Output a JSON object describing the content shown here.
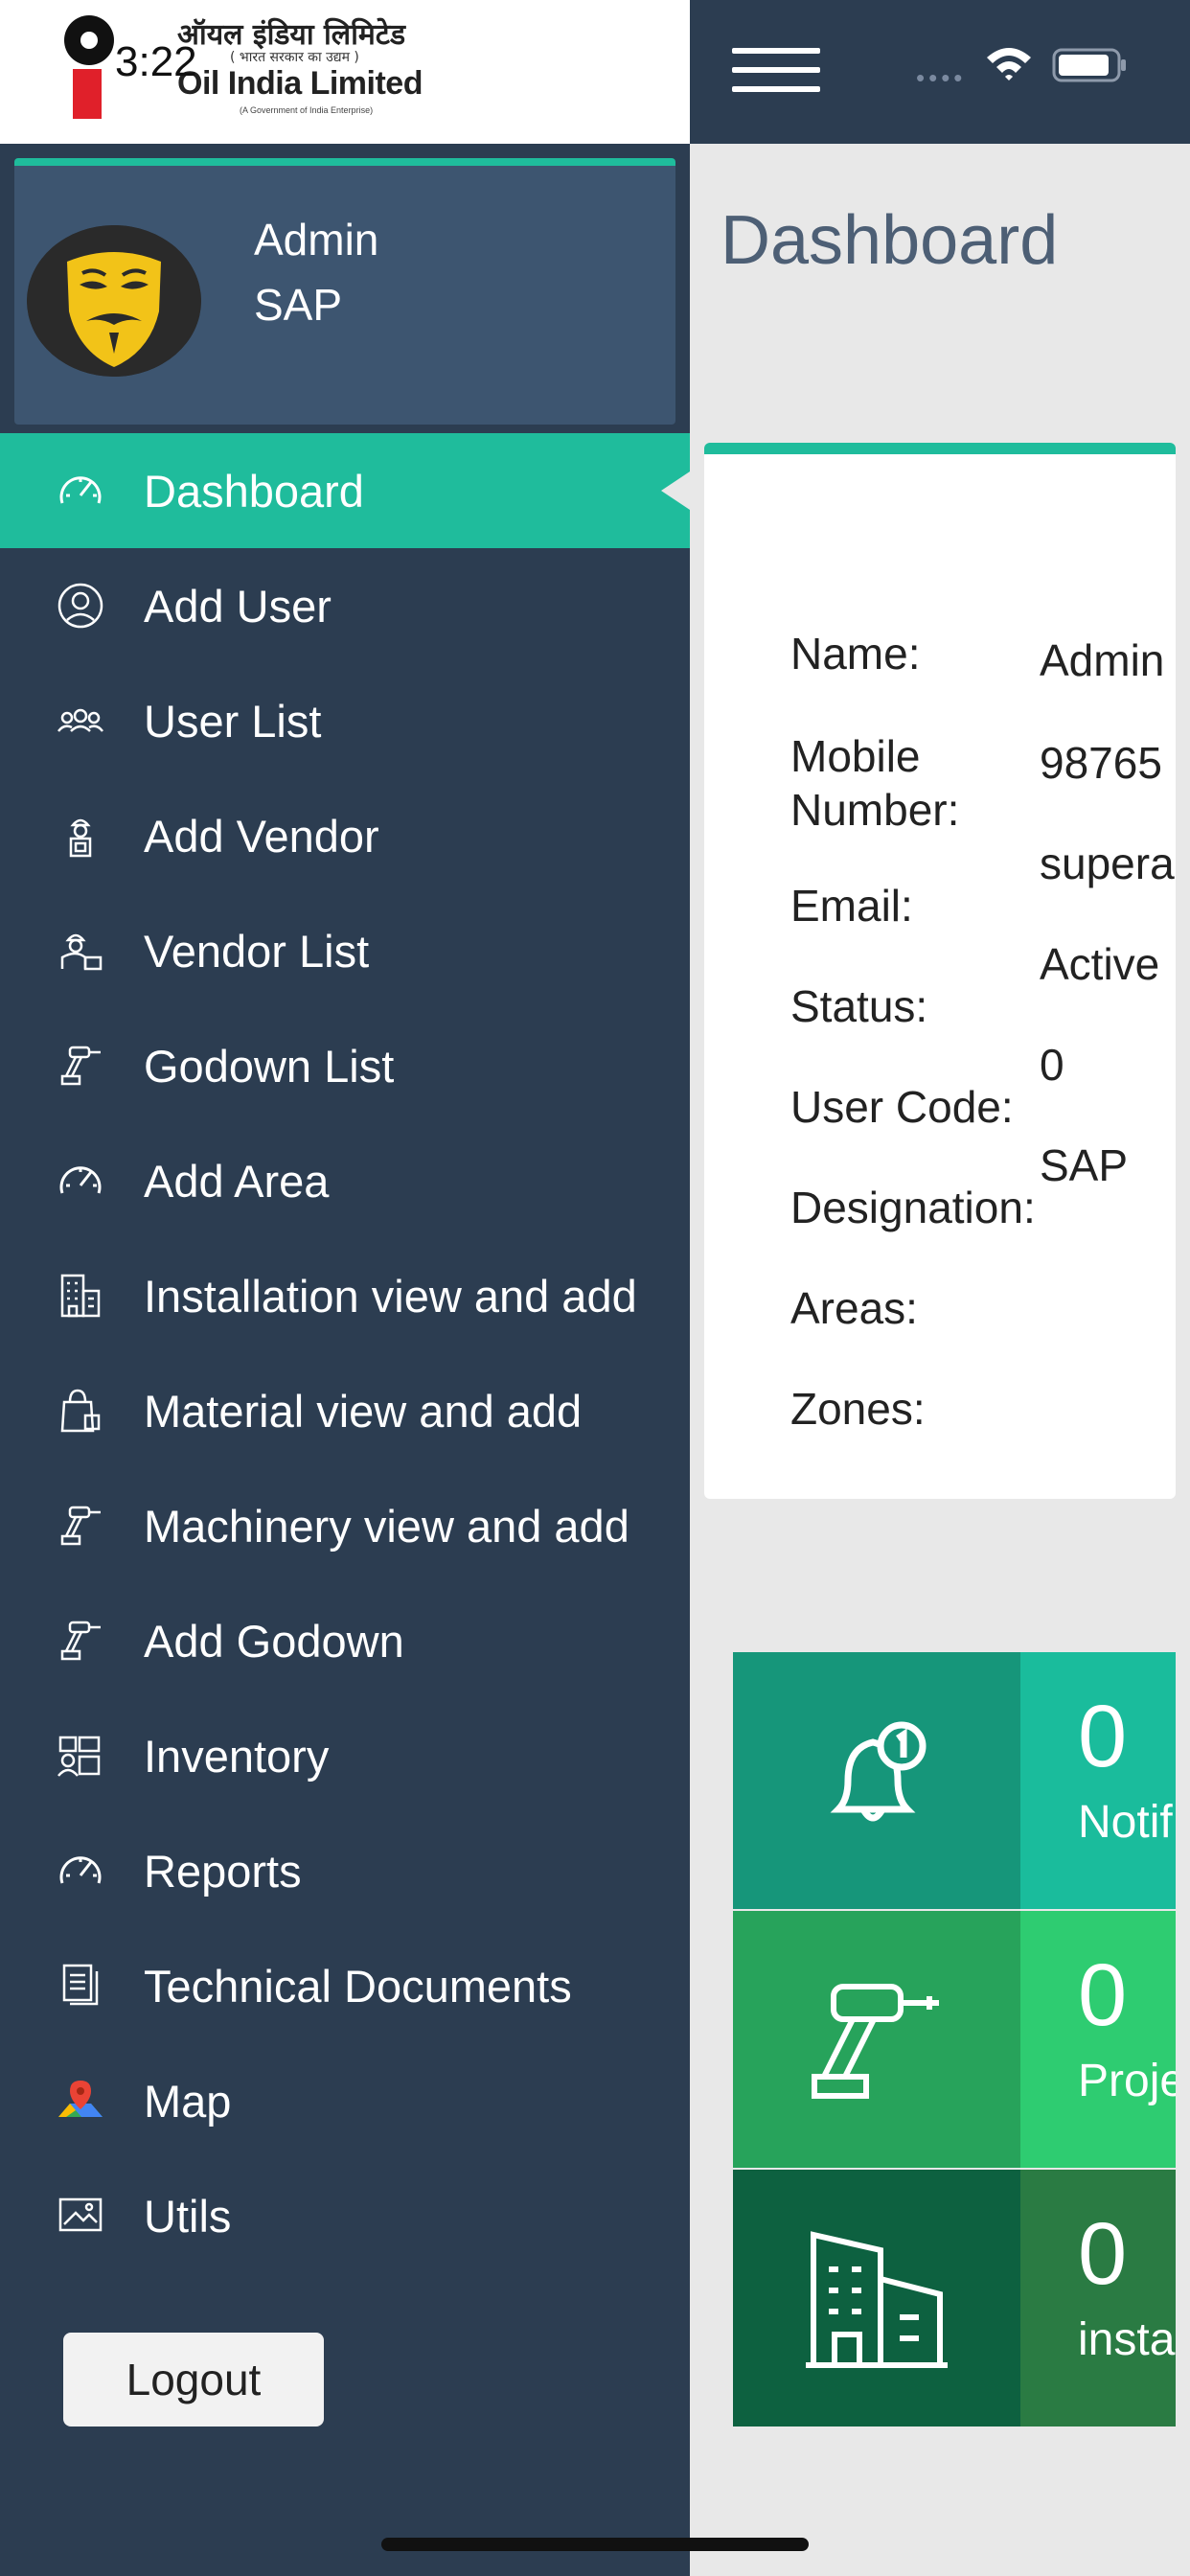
{
  "status_bar": {
    "time": "3:22",
    "signal_dots": "••••"
  },
  "logo": {
    "hindi_name": "ऑयल इंडिया लिमिटेड",
    "hindi_sub": "( भारत सरकार का उद्यम )",
    "english_name": "Oil India Limited",
    "english_sub": "(A Government of India Enterprise)"
  },
  "profile": {
    "name": "Admin",
    "role": "SAP"
  },
  "menu": {
    "items": [
      {
        "label": "Dashboard",
        "icon": "speedometer-icon",
        "active": true
      },
      {
        "label": "Add User",
        "icon": "user-circle-icon"
      },
      {
        "label": "User List",
        "icon": "users-group-icon"
      },
      {
        "label": "Add Vendor",
        "icon": "vendor-icon"
      },
      {
        "label": "Vendor List",
        "icon": "vendor-worker-icon"
      },
      {
        "label": "Godown List",
        "icon": "drill-icon"
      },
      {
        "label": "Add Area",
        "icon": "speedometer-icon"
      },
      {
        "label": "Installation view and add",
        "icon": "building-icon"
      },
      {
        "label": "Material view and add",
        "icon": "shopping-bag-icon"
      },
      {
        "label": "Machinery view and add",
        "icon": "drill-icon"
      },
      {
        "label": "Add Godown",
        "icon": "drill-icon"
      },
      {
        "label": "Inventory",
        "icon": "inventory-icon"
      },
      {
        "label": "Reports",
        "icon": "speedometer-icon"
      },
      {
        "label": "Technical Documents",
        "icon": "document-icon"
      },
      {
        "label": "Map",
        "icon": "map-icon"
      },
      {
        "label": "Utils",
        "icon": "image-icon"
      }
    ],
    "logout_label": "Logout"
  },
  "dashboard": {
    "title": "Dashboard",
    "fields": {
      "name_label": "Name:",
      "name_value": "Admin",
      "mobile_label_1": "Mobile",
      "mobile_label_2": "Number:",
      "mobile_value": "98765",
      "email_label": "Email:",
      "email_value": "supera",
      "status_label": "Status:",
      "status_value": "Active",
      "user_code_label": "User Code:",
      "user_code_value": "0",
      "designation_label": "Designation:",
      "designation_value": "SAP",
      "areas_label": "Areas:",
      "zones_label": "Zones:"
    },
    "stats": [
      {
        "count": "0",
        "label": "Notif",
        "icon": "bell-notification-icon",
        "icon_bg": "#16967a",
        "num_bg": "#1abc9c"
      },
      {
        "count": "0",
        "label": "Proje",
        "icon": "drill-icon",
        "icon_bg": "#27a35b",
        "num_bg": "#2ecc71"
      },
      {
        "count": "0",
        "label": "insta",
        "icon": "building-icon",
        "icon_bg": "#0d6140",
        "num_bg": "#2a7b43"
      }
    ]
  },
  "colors": {
    "sidebar": "#2c3d51",
    "accent": "#1fbc9c",
    "background": "#e8e8e8",
    "title": "#4d5f75"
  }
}
